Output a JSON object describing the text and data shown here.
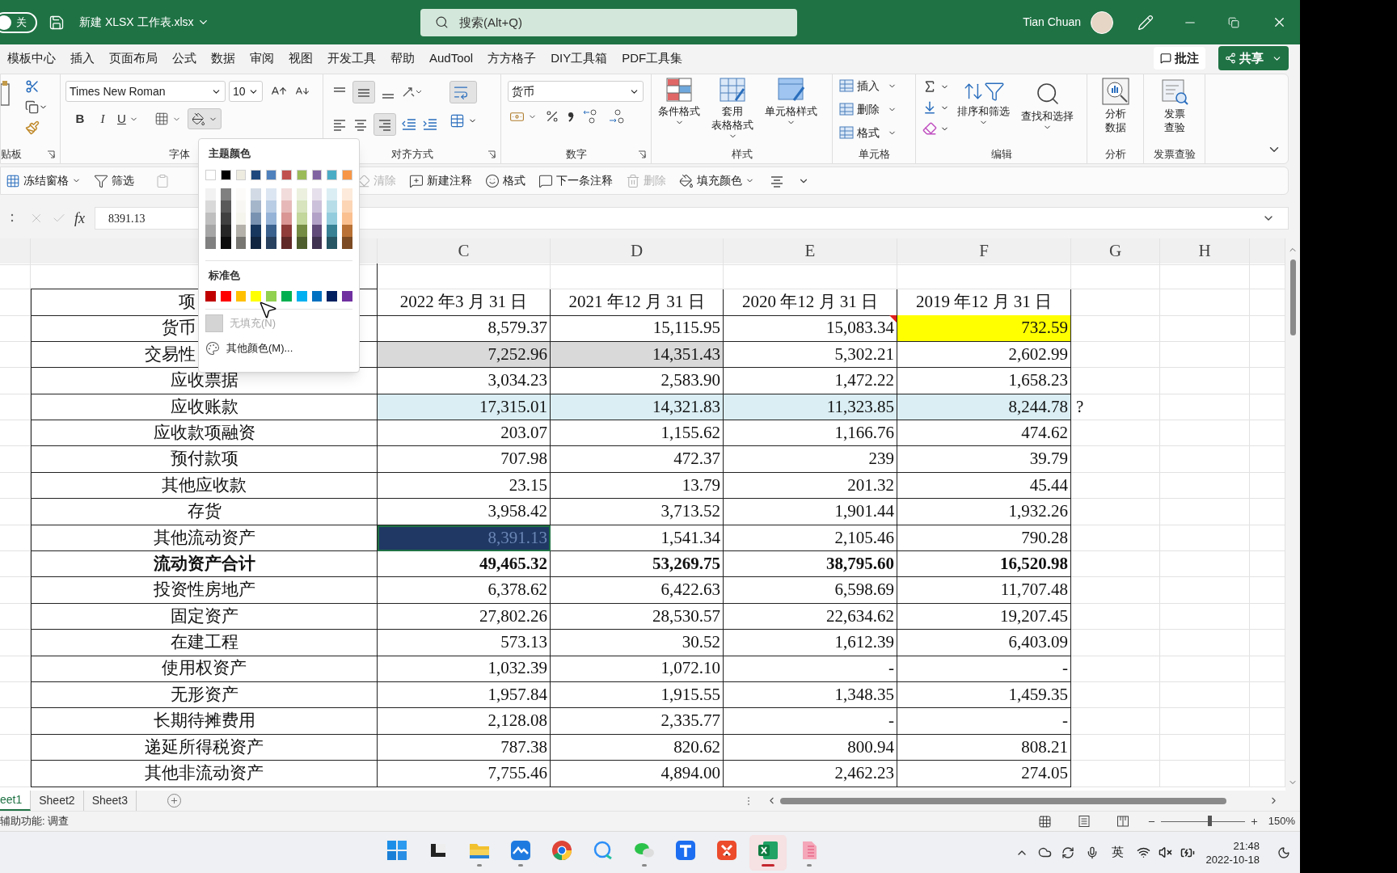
{
  "title_bar": {
    "autosave": {
      "label": "关",
      "on": false
    },
    "file_name": "新建 XLSX 工作表.xlsx",
    "search": {
      "placeholder": "搜索(Alt+Q)"
    },
    "user_name": "Tian Chuan"
  },
  "ribbon_tabs": [
    {
      "label": "模板中心",
      "selected": false
    },
    {
      "label": "插入",
      "selected": false
    },
    {
      "label": "页面布局",
      "selected": false
    },
    {
      "label": "公式",
      "selected": false
    },
    {
      "label": "数据",
      "selected": false
    },
    {
      "label": "审阅",
      "selected": false
    },
    {
      "label": "视图",
      "selected": false
    },
    {
      "label": "开发工具",
      "selected": false
    },
    {
      "label": "帮助",
      "selected": false
    },
    {
      "label": "AudTool",
      "selected": false
    },
    {
      "label": "方方格子",
      "selected": false
    },
    {
      "label": "DIY工具箱",
      "selected": false
    },
    {
      "label": "PDF工具集",
      "selected": false
    }
  ],
  "comment_button": "批注",
  "share_button": "共享",
  "ribbon": {
    "clipboard": {
      "label": "贴板"
    },
    "font": {
      "font_name": "Times New Roman",
      "font_size": "10",
      "bold": "B",
      "italic": "I",
      "underline": "U",
      "label": "字体"
    },
    "alignment": {
      "label": "对齐方式"
    },
    "number": {
      "format": "货币",
      "label": "数字"
    },
    "styles": {
      "conditional": "条件格式",
      "table_format": [
        "套用",
        "表格格式"
      ],
      "cell_styles": "单元格样式",
      "label": "样式"
    },
    "cells": {
      "buttons": [
        "插入",
        "删除",
        "格式"
      ],
      "label": "单元格"
    },
    "editing": {
      "sort": "排序和筛选",
      "find": "查找和选择",
      "label": "编辑"
    },
    "analysis": {
      "button": "分析数据",
      "label": "分析"
    },
    "invoice": {
      "button": "发票查验",
      "label": "发票查验"
    }
  },
  "quick_toolbar": {
    "left": [
      {
        "kind": "freeze",
        "label": "冻结窗格",
        "disabled": false,
        "has_menu": true
      },
      {
        "kind": "filter",
        "label": "筛选",
        "disabled": false,
        "has_menu": false
      }
    ],
    "right": [
      {
        "kind": "clear",
        "label": "清除",
        "disabled": true,
        "has_menu": false
      },
      {
        "kind": "new-comment",
        "label": "新建注释",
        "disabled": false,
        "has_menu": false
      },
      {
        "kind": "format",
        "label": "格式",
        "disabled": false,
        "has_menu": false
      },
      {
        "kind": "next-comment",
        "label": "下一条注释",
        "disabled": false,
        "has_menu": false
      },
      {
        "kind": "delete",
        "label": "删除",
        "disabled": true,
        "has_menu": false
      },
      {
        "kind": "fill",
        "label": "填充颜色",
        "disabled": false,
        "has_menu": true
      }
    ]
  },
  "formula_bar": {
    "function_label": "fx",
    "value": "8391.13"
  },
  "grid": {
    "column_headers": [
      "C",
      "D",
      "E",
      "F",
      "G",
      "H"
    ],
    "table_header": {
      "label": "项",
      "cut": true,
      "columns": [
        "2022 年3 月 31 日",
        "2021 年12 月 31 日",
        "2020 年12 月 31 日",
        "2019 年12 月 31 日"
      ]
    },
    "rows": [
      {
        "label": "货币",
        "cut": true,
        "bold": false,
        "cells": [
          {
            "text": "8,579.37"
          },
          {
            "text": "15,115.95"
          },
          {
            "text": "15,083.34",
            "comment": true
          },
          {
            "text": "732.59",
            "color": "#ffff00"
          }
        ]
      },
      {
        "label": "交易性",
        "cut": true,
        "bold": false,
        "cells": [
          {
            "text": "7,252.96",
            "color": "#d9d9d9"
          },
          {
            "text": "14,351.43",
            "color": "#d9d9d9"
          },
          {
            "text": "5,302.21"
          },
          {
            "text": "2,602.99"
          }
        ]
      },
      {
        "label": "应收票据",
        "bold": false,
        "cells": [
          {
            "text": "3,034.23"
          },
          {
            "text": "2,583.90"
          },
          {
            "text": "1,472.22"
          },
          {
            "text": "1,658.23"
          }
        ]
      },
      {
        "label": "应收账款",
        "bold": false,
        "note": "?",
        "cells": [
          {
            "text": "17,315.01",
            "color": "#daeef3"
          },
          {
            "text": "14,321.83",
            "color": "#daeef3"
          },
          {
            "text": "11,323.85",
            "color": "#daeef3"
          },
          {
            "text": "8,244.78",
            "color": "#daeef3"
          }
        ]
      },
      {
        "label": "应收款项融资",
        "bold": false,
        "cells": [
          {
            "text": "203.07"
          },
          {
            "text": "1,155.62"
          },
          {
            "text": "1,166.76"
          },
          {
            "text": "474.62"
          }
        ]
      },
      {
        "label": "预付款项",
        "bold": false,
        "cells": [
          {
            "text": "707.98"
          },
          {
            "text": "472.37"
          },
          {
            "text": "239"
          },
          {
            "text": "39.79"
          }
        ]
      },
      {
        "label": "其他应收款",
        "bold": false,
        "cells": [
          {
            "text": "23.15"
          },
          {
            "text": "13.79"
          },
          {
            "text": "201.32"
          },
          {
            "text": "45.44"
          }
        ]
      },
      {
        "label": "存货",
        "bold": false,
        "cells": [
          {
            "text": "3,958.42"
          },
          {
            "text": "3,713.52"
          },
          {
            "text": "1,901.44"
          },
          {
            "text": "1,932.26"
          }
        ]
      },
      {
        "label": "其他流动资产",
        "bold": false,
        "cells": [
          {
            "text": "8,391.13",
            "color": "#1f3864",
            "selected": true
          },
          {
            "text": "1,541.34"
          },
          {
            "text": "2,105.46"
          },
          {
            "text": "790.28"
          }
        ]
      },
      {
        "label": "流动资产合计",
        "bold": true,
        "cells": [
          {
            "text": "49,465.32"
          },
          {
            "text": "53,269.75"
          },
          {
            "text": "38,795.60"
          },
          {
            "text": "16,520.98"
          }
        ]
      },
      {
        "label": "投资性房地产",
        "bold": false,
        "cells": [
          {
            "text": "6,378.62"
          },
          {
            "text": "6,422.63"
          },
          {
            "text": "6,598.69"
          },
          {
            "text": "11,707.48"
          }
        ]
      },
      {
        "label": "固定资产",
        "bold": false,
        "cells": [
          {
            "text": "27,802.26"
          },
          {
            "text": "28,530.57"
          },
          {
            "text": "22,634.62"
          },
          {
            "text": "19,207.45"
          }
        ]
      },
      {
        "label": "在建工程",
        "bold": false,
        "cells": [
          {
            "text": "573.13"
          },
          {
            "text": "30.52"
          },
          {
            "text": "1,612.39"
          },
          {
            "text": "6,403.09"
          }
        ]
      },
      {
        "label": "使用权资产",
        "bold": false,
        "cells": [
          {
            "text": "1,032.39"
          },
          {
            "text": "1,072.10"
          },
          {
            "text": "-"
          },
          {
            "text": "-"
          }
        ]
      },
      {
        "label": "无形资产",
        "bold": false,
        "cells": [
          {
            "text": "1,957.84"
          },
          {
            "text": "1,915.55"
          },
          {
            "text": "1,348.35"
          },
          {
            "text": "1,459.35"
          }
        ]
      },
      {
        "label": "长期待摊费用",
        "bold": false,
        "cells": [
          {
            "text": "2,128.08"
          },
          {
            "text": "2,335.77"
          },
          {
            "text": "-"
          },
          {
            "text": "-"
          }
        ]
      },
      {
        "label": "递延所得税资产",
        "bold": false,
        "cells": [
          {
            "text": "787.38"
          },
          {
            "text": "820.62"
          },
          {
            "text": "800.94"
          },
          {
            "text": "808.21"
          }
        ]
      },
      {
        "label": "其他非流动资产",
        "bold": false,
        "cells": [
          {
            "text": "7,755.46"
          },
          {
            "text": "4,894.00"
          },
          {
            "text": "2,462.23"
          },
          {
            "text": "274.05"
          }
        ]
      }
    ]
  },
  "color_menu": {
    "theme_heading": "主题颜色",
    "theme_colors": [
      {
        "color": "#ffffff"
      },
      {
        "color": "#000000"
      },
      {
        "color": "#eeece1"
      },
      {
        "color": "#1f497d"
      },
      {
        "color": "#4f81bd"
      },
      {
        "color": "#c0504d"
      },
      {
        "color": "#9bbb59"
      },
      {
        "color": "#8064a2"
      },
      {
        "color": "#4bacc6"
      },
      {
        "color": "#f79646"
      }
    ],
    "standard_heading": "标准色",
    "standard_colors": [
      {
        "color": "#c00000"
      },
      {
        "color": "#ff0000"
      },
      {
        "color": "#ffc000"
      },
      {
        "color": "#ffff00"
      },
      {
        "color": "#92d050"
      },
      {
        "color": "#00b050"
      },
      {
        "color": "#00b0f0"
      },
      {
        "color": "#0070c0"
      },
      {
        "color": "#002060"
      },
      {
        "color": "#7030a0"
      }
    ],
    "no_fill": {
      "label": "无填充(N)",
      "disabled": true
    },
    "more_colors": "其他颜色(M)..."
  },
  "sheet_tabs": [
    {
      "label": "eet1",
      "selected": true
    },
    {
      "label": "Sheet2",
      "selected": false
    },
    {
      "label": "Sheet3",
      "selected": false
    }
  ],
  "status_bar": {
    "accessibility": "辅助功能: 调查",
    "zoom": {
      "level": 0.58,
      "reading": "150%"
    }
  },
  "taskbar": {
    "apps": [
      {
        "kind": "start",
        "running": false,
        "active": false
      },
      {
        "kind": "taskview",
        "running": false,
        "active": false
      },
      {
        "kind": "folder",
        "running": true,
        "active": false
      },
      {
        "kind": "meeting",
        "running": true,
        "active": false
      },
      {
        "kind": "browser",
        "running": false,
        "active": false
      },
      {
        "kind": "chat",
        "running": false,
        "active": false
      },
      {
        "kind": "messenger",
        "running": true,
        "active": false
      },
      {
        "kind": "tool",
        "running": false,
        "active": false
      },
      {
        "kind": "red-app",
        "running": false,
        "active": false
      },
      {
        "kind": "spreadsheet",
        "running": true,
        "active": true
      },
      {
        "kind": "document",
        "running": true,
        "active": false
      }
    ],
    "ime": "英",
    "time": "21:48",
    "date": "2022-10-18"
  }
}
